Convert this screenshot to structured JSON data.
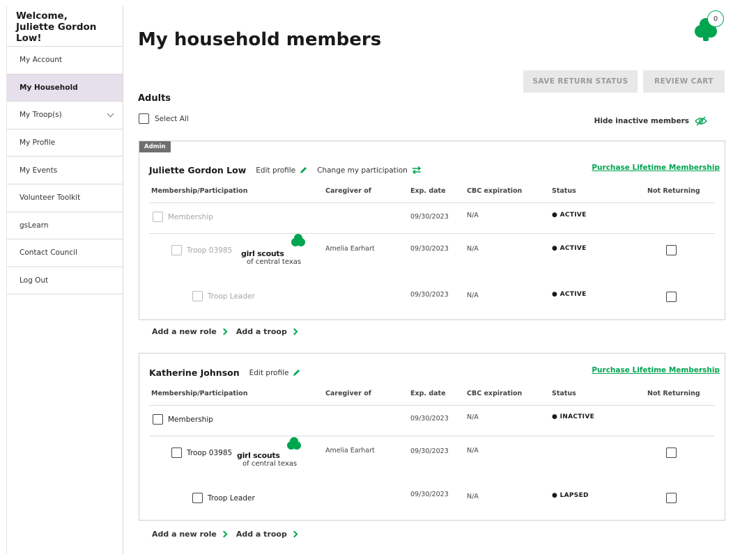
{
  "sidebar": {
    "welcome_line1": "Welcome,",
    "welcome_line2": "Juliette Gordon Low!",
    "items": [
      {
        "label": "My Account"
      },
      {
        "label": "My Household"
      },
      {
        "label": "My Troop(s)"
      },
      {
        "label": "My Profile"
      },
      {
        "label": "My Events"
      },
      {
        "label": "Volunteer Toolkit"
      },
      {
        "label": "gsLearn"
      },
      {
        "label": "Contact Council"
      },
      {
        "label": "Log Out"
      }
    ]
  },
  "header": {
    "title": "My household members",
    "cart_count": "0",
    "save_label": "SAVE RETURN STATUS",
    "review_label": "REVIEW CART"
  },
  "section": {
    "adults_label": "Adults",
    "select_all": "Select All",
    "hide_inactive": "Hide inactive members"
  },
  "columns": {
    "membership": "Membership/Participation",
    "caregiver": "Caregiver of",
    "exp": "Exp. date",
    "cbc": "CBC expiration",
    "status": "Status",
    "not_returning": "Not Returning"
  },
  "members": [
    {
      "tag": "Admin",
      "name": "Juliette Gordon Low",
      "edit_profile": "Edit profile",
      "change_participation": "Change my participation",
      "purchase": "Purchase Lifetime Membership",
      "rows": [
        {
          "label": "Membership",
          "caregiver": "",
          "exp": "09/30/2023",
          "cbc": "N/A",
          "status": "ACTIVE"
        },
        {
          "label": "Troop 03985",
          "caregiver": "Amelia Earhart",
          "exp": "09/30/2023",
          "cbc": "N/A",
          "status": "ACTIVE"
        },
        {
          "label": "Troop Leader",
          "caregiver": "",
          "exp": "09/30/2023",
          "cbc": "N/A",
          "status": "ACTIVE"
        }
      ],
      "add_role": "Add a new role",
      "add_troop": "Add a troop"
    },
    {
      "name": "Katherine Johnson",
      "edit_profile": "Edit profile",
      "purchase": "Purchase Lifetime Membership",
      "rows": [
        {
          "label": "Membership",
          "caregiver": "",
          "exp": "09/30/2023",
          "cbc": "N/A",
          "status": "INACTIVE"
        },
        {
          "label": "Troop 03985",
          "caregiver": "Amelia Earhart",
          "exp": "09/30/2023",
          "cbc": "N/A",
          "status": ""
        },
        {
          "label": "Troop Leader",
          "caregiver": "",
          "exp": "09/30/2023",
          "cbc": "N/A",
          "status": "LAPSED"
        }
      ],
      "add_role": "Add a new role",
      "add_troop": "Add a troop"
    }
  ],
  "logo": {
    "line1": "girl scouts",
    "line2": "of central texas"
  },
  "colors": {
    "brand_green": "#00a550",
    "active_nav": "#e6dfec",
    "disabled_btn": "#e8e8e8"
  }
}
